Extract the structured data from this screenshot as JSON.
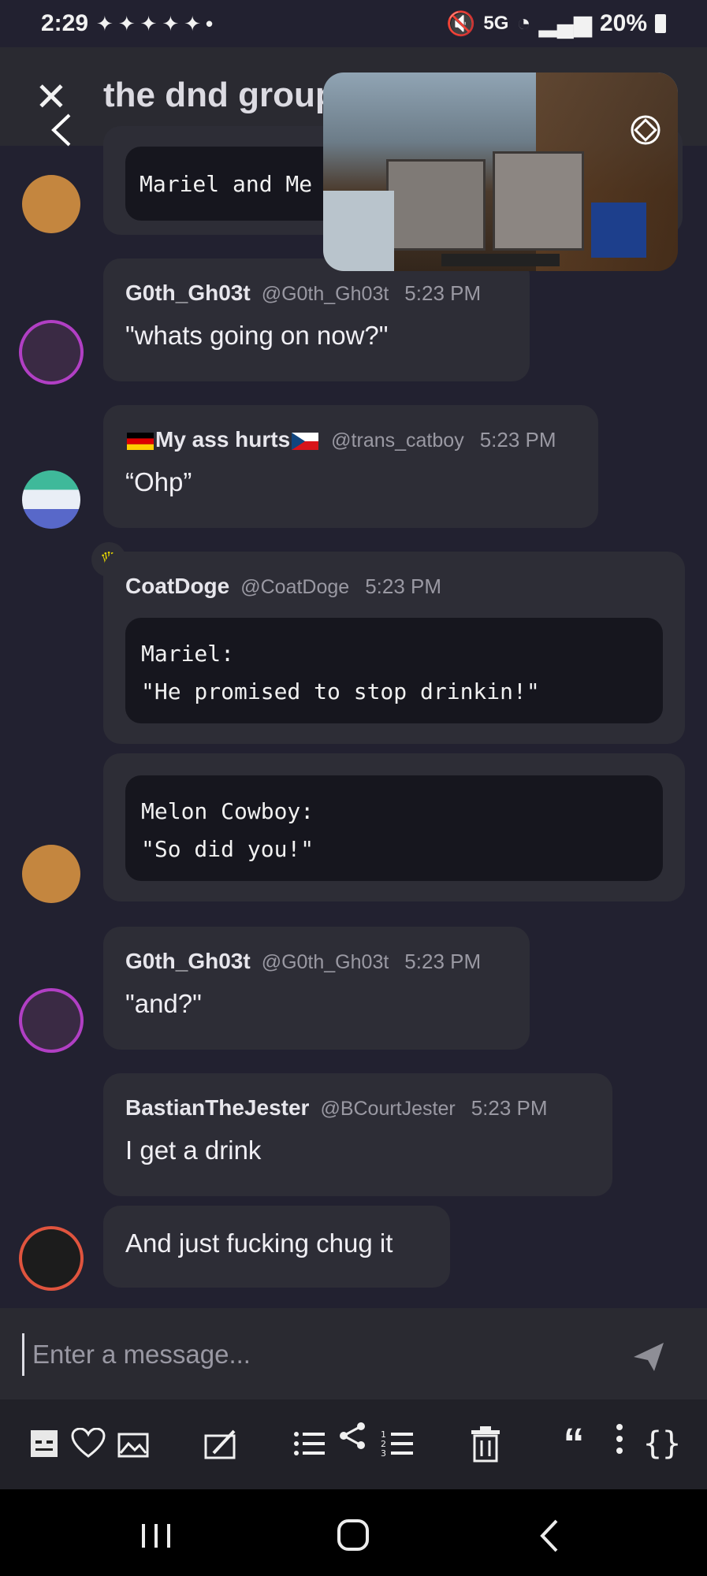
{
  "status_bar": {
    "time": "2:29",
    "battery": "20%",
    "network": "5G"
  },
  "header": {
    "title": "the dnd group"
  },
  "messages": [
    {
      "code": "Mariel and Me"
    },
    {
      "author": "G0th_Gh03t",
      "handle": "@G0th_Gh03t",
      "time": "5:23 PM",
      "text": "\"whats going on now?\""
    },
    {
      "author": "My ass hurts",
      "handle": "@trans_catboy",
      "time": "5:23 PM",
      "text": "“Ohp”"
    },
    {
      "author": "CoatDoge",
      "handle": "@CoatDoge",
      "time": "5:23 PM",
      "code_line1": "Mariel:",
      "code_line2": "\"He promised to stop drinkin!\""
    },
    {
      "code_line1": "Melon Cowboy:",
      "code_line2": "\"So did you!\""
    },
    {
      "author": "G0th_Gh03t",
      "handle": "@G0th_Gh03t",
      "time": "5:23 PM",
      "text": "\"and?\""
    },
    {
      "author": "BastianTheJester",
      "handle": "@BCourtJester",
      "time": "5:23 PM",
      "text": "I get a drink"
    },
    {
      "text": "And just fucking chug it"
    }
  ],
  "composer": {
    "placeholder": "Enter a message..."
  },
  "toolbar": [
    "text-format-icon",
    "heart-icon",
    "image-icon",
    "draw-icon",
    "bullet-list-icon",
    "share-icon",
    "numbered-list-icon",
    "trash-icon",
    "quote-icon",
    "more-icon",
    "code-braces-icon"
  ],
  "colors": {
    "background": "#222130",
    "bubble": "#2d2d36",
    "code": "#16161e",
    "header": "#2a2a31",
    "crown": "#e6d700"
  }
}
